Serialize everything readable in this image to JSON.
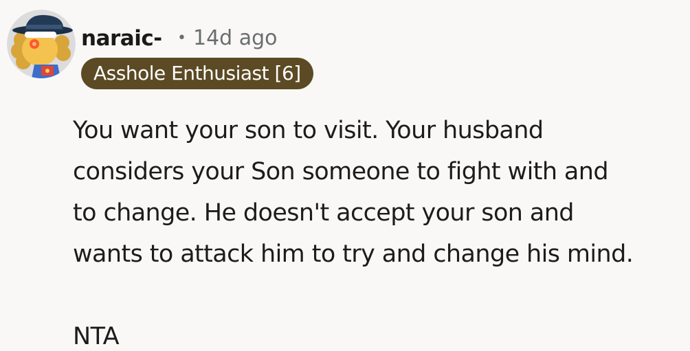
{
  "comment": {
    "author": "naraic-",
    "separator": "•",
    "timestamp": "14d ago",
    "flair": "Asshole Enthusiast [6]",
    "flair_color": "#5c4a24",
    "avatar_icon": "snoo-avatar-icon",
    "paragraphs": [
      "You want your son to visit. Your husband\nconsiders your Son someone to fight with and\nto change. He doesn't accept your son and\nwants to attack him to try and change his mind.",
      "NTA"
    ]
  },
  "colors": {
    "background": "#f9f8f6",
    "text": "#1c1c1c",
    "meta_text": "#6a6d70"
  }
}
